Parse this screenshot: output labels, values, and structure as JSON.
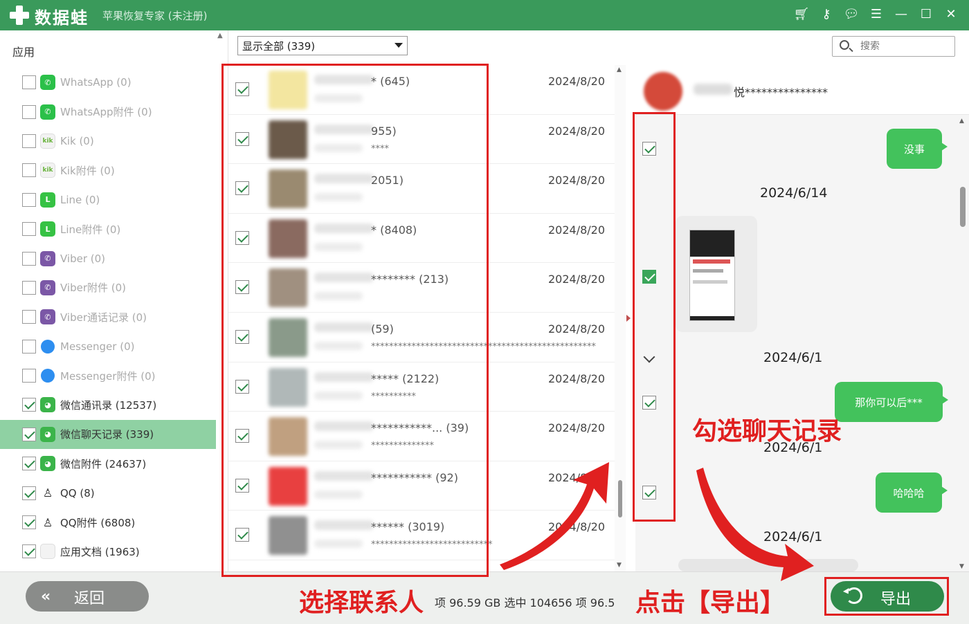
{
  "window": {
    "brand": "数据蛙",
    "subtitle": "苹果恢复专家 (未注册)"
  },
  "title_icons": [
    "cart-icon",
    "key-icon",
    "chat-icon",
    "feedback-icon",
    "minimize-icon",
    "maximize-icon",
    "close-icon"
  ],
  "sidebar": {
    "header": "应用",
    "items": [
      {
        "label": "WhatsApp (0)",
        "icon": "whatsapp-icon",
        "glyph": "✆",
        "checked": false,
        "active": false
      },
      {
        "label": "WhatsApp附件 (0)",
        "icon": "whatsapp-icon",
        "glyph": "✆",
        "checked": false,
        "active": false
      },
      {
        "label": "Kik (0)",
        "icon": "kik-icon",
        "glyph": "kik",
        "checked": false,
        "active": false
      },
      {
        "label": "Kik附件 (0)",
        "icon": "kik-icon",
        "glyph": "kik",
        "checked": false,
        "active": false
      },
      {
        "label": "Line (0)",
        "icon": "line-icon",
        "glyph": "L",
        "checked": false,
        "active": false
      },
      {
        "label": "Line附件 (0)",
        "icon": "line-icon",
        "glyph": "L",
        "checked": false,
        "active": false
      },
      {
        "label": "Viber (0)",
        "icon": "viber-icon",
        "glyph": "✆",
        "checked": false,
        "active": false
      },
      {
        "label": "Viber附件 (0)",
        "icon": "viber-icon",
        "glyph": "✆",
        "checked": false,
        "active": false
      },
      {
        "label": "Viber通话记录 (0)",
        "icon": "viber-icon",
        "glyph": "✆",
        "checked": false,
        "active": false
      },
      {
        "label": "Messenger (0)",
        "icon": "messenger-icon",
        "glyph": "",
        "checked": false,
        "active": false
      },
      {
        "label": "Messenger附件 (0)",
        "icon": "messenger-icon",
        "glyph": "",
        "checked": false,
        "active": false
      },
      {
        "label": "微信通讯录 (12537)",
        "icon": "wechat-icon",
        "glyph": "◕",
        "checked": true,
        "active": false
      },
      {
        "label": "微信聊天记录 (339)",
        "icon": "wechat-icon",
        "glyph": "◕",
        "checked": true,
        "active": true
      },
      {
        "label": "微信附件 (24637)",
        "icon": "wechat-icon",
        "glyph": "◕",
        "checked": true,
        "active": false
      },
      {
        "label": "QQ (8)",
        "icon": "qq-icon",
        "glyph": "♙",
        "checked": true,
        "active": false
      },
      {
        "label": "QQ附件 (6808)",
        "icon": "qq-icon",
        "glyph": "♙",
        "checked": true,
        "active": false
      },
      {
        "label": "应用文档 (1963)",
        "icon": "document-icon",
        "glyph": "",
        "checked": true,
        "active": false
      }
    ]
  },
  "filter": {
    "value": "显示全部 (339)"
  },
  "search": {
    "placeholder": "搜索"
  },
  "contacts": [
    {
      "name": "* (645)",
      "preview": "",
      "date": "2024/8/20",
      "avatar_color": "#f3e6a0"
    },
    {
      "name": "955)",
      "preview": "****",
      "date": "2024/8/20",
      "avatar_color": "#6b5a4a"
    },
    {
      "name": "2051)",
      "preview": "",
      "date": "2024/8/20",
      "avatar_color": "#9a8a70"
    },
    {
      "name": "* (8408)",
      "preview": "",
      "date": "2024/8/20",
      "avatar_color": "#8a6a60"
    },
    {
      "name": "******** (213)",
      "preview": "",
      "date": "2024/8/20",
      "avatar_color": "#a09080"
    },
    {
      "name": "(59)",
      "preview": "**************************************************",
      "date": "2024/8/20",
      "avatar_color": "#8a9a8a"
    },
    {
      "name": "***** (2122)",
      "preview": "**********",
      "date": "2024/8/20",
      "avatar_color": "#b0b8b8"
    },
    {
      "name": "***********... (39)",
      "preview": "**************",
      "date": "2024/8/20",
      "avatar_color": "#c0a080"
    },
    {
      "name": "*********** (92)",
      "preview": "",
      "date": "2024/8/20",
      "avatar_color": "#e84040"
    },
    {
      "name": "****** (3019)",
      "preview": "***************************",
      "date": "2024/8/20",
      "avatar_color": "#909090"
    }
  ],
  "chat": {
    "contact_name": "悦***************",
    "messages": [
      {
        "text": "没事"
      },
      {
        "date": "2024/6/14"
      },
      {
        "date": "2024/6/1"
      },
      {
        "text": "那你可以后***"
      },
      {
        "date": "2024/6/1"
      },
      {
        "text": "哈哈哈"
      },
      {
        "date": "2024/6/1"
      }
    ]
  },
  "bottom": {
    "back_label": "返回",
    "status": "项 96.59 GB  选中 104656 项 96.5",
    "export_label": "导出"
  },
  "annotations": {
    "select_contacts": "选择联系人",
    "check_chats": "勾选聊天记录",
    "click_export": "点击【导出】"
  },
  "colors": {
    "brand_green": "#3a9a5b",
    "active_green": "#8fd1a3",
    "bubble_green": "#43c25c",
    "annotation_red": "#e02020"
  }
}
